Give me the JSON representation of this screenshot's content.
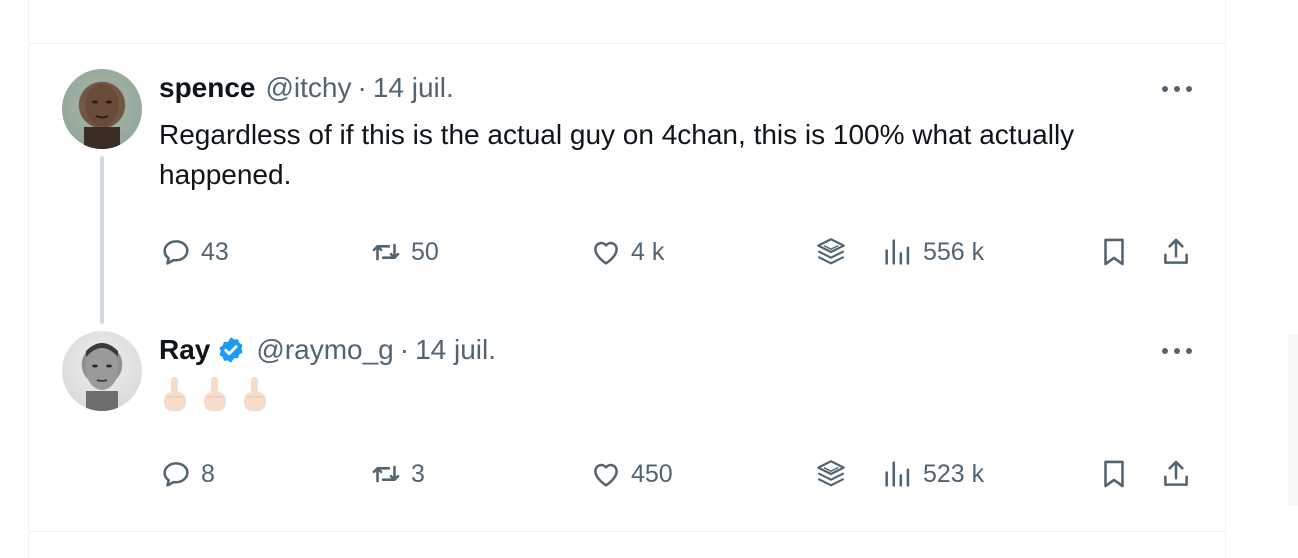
{
  "colors": {
    "text": "#0f1419",
    "secondary": "#536471",
    "verified": "#1d9bf0",
    "thread_line": "#cfd9de",
    "divider": "#eff3f4"
  },
  "tweets": [
    {
      "name": "spence",
      "handle": "@itchy",
      "separator": "·",
      "date": "14 juil.",
      "verified": false,
      "text": "Regardless of if this is the actual guy on 4chan, this is 100% what actually happened.",
      "replies": "43",
      "retweets": "50",
      "likes": "4 k",
      "views": "556 k",
      "icons": [
        "reply-icon",
        "retweet-icon",
        "like-icon",
        "layers-icon",
        "views-icon",
        "bookmark-icon",
        "share-icon",
        "more-icon"
      ]
    },
    {
      "name": "Ray",
      "handle": "@raymo_g",
      "separator": "·",
      "date": "14 juil.",
      "verified": true,
      "emoji": "👆🏻👆🏻👆🏻",
      "replies": "8",
      "retweets": "3",
      "likes": "450",
      "views": "523 k",
      "icons": [
        "reply-icon",
        "retweet-icon",
        "like-icon",
        "layers-icon",
        "views-icon",
        "bookmark-icon",
        "share-icon",
        "more-icon"
      ]
    }
  ]
}
